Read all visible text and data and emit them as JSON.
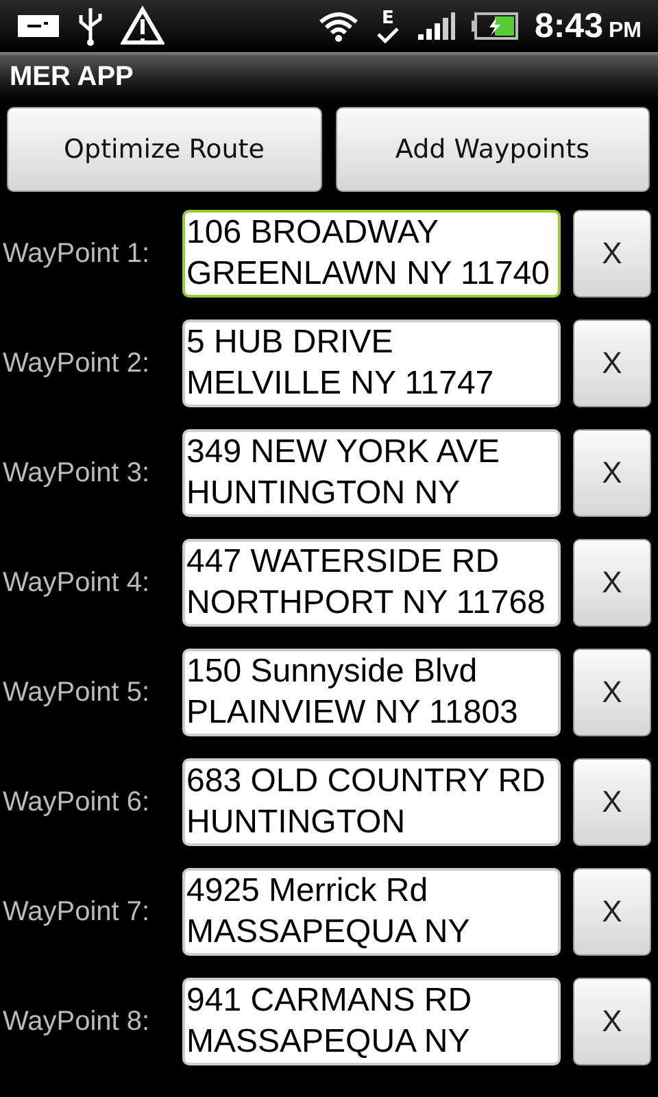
{
  "status_bar": {
    "time": "8:43",
    "ampm": "PM",
    "network_letter": "E"
  },
  "title": "MER APP",
  "buttons": [
    "Optimize Route",
    "Add Waypoints"
  ],
  "waypoints": [
    {
      "label": "WayPoint 1:",
      "value": "106 BROADWAY\nGREENLAWN NY 11740",
      "focused": true,
      "remove": "X"
    },
    {
      "label": "WayPoint 2:",
      "value": "5 HUB DRIVE\nMELVILLE NY 11747",
      "focused": false,
      "remove": "X"
    },
    {
      "label": "WayPoint 3:",
      "value": "349 NEW YORK AVE\nHUNTINGTON NY",
      "focused": false,
      "remove": "X"
    },
    {
      "label": "WayPoint 4:",
      "value": "447 WATERSIDE RD\nNORTHPORT NY 11768",
      "focused": false,
      "remove": "X"
    },
    {
      "label": "WayPoint 5:",
      "value": "150 Sunnyside Blvd\nPLAINVIEW NY 11803",
      "focused": false,
      "remove": "X"
    },
    {
      "label": "WayPoint 6:",
      "value": "683 OLD COUNTRY RD\nHUNTINGTON",
      "focused": false,
      "remove": "X"
    },
    {
      "label": "WayPoint 7:",
      "value": "4925 Merrick Rd\nMASSAPEQUA NY",
      "focused": false,
      "remove": "X"
    },
    {
      "label": "WayPoint 8:",
      "value": "941 CARMANS RD\nMASSAPEQUA NY",
      "focused": false,
      "remove": "X"
    }
  ]
}
